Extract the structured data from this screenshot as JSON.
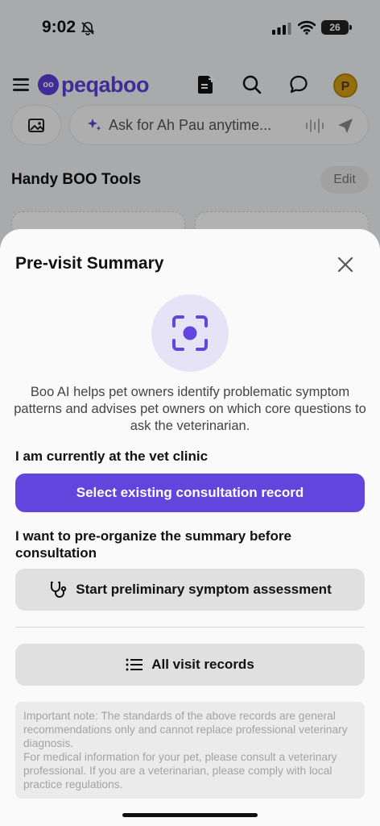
{
  "status": {
    "time": "9:02",
    "battery": "26"
  },
  "nav": {
    "brand": "peqaboo",
    "logo_mark": "oo",
    "avatar_letter": "P"
  },
  "search": {
    "placeholder": "Ask for Ah Pau anytime..."
  },
  "tools": {
    "title": "Handy BOO Tools",
    "edit_label": "Edit"
  },
  "sheet": {
    "title": "Pre-visit Summary",
    "description": "Boo AI helps pet owners identify problematic symptom patterns and advises pet owners on which core questions to ask the veterinarian.",
    "section1_label": "I am currently at the vet clinic",
    "select_record_button": "Select existing consultation record",
    "section2_label": "I want to pre-organize the summary before consultation",
    "assessment_button": "Start preliminary symptom assessment",
    "records_button": "All visit records",
    "note": "Important note: The standards of the above records are general recommendations only and cannot replace professional veterinary diagnosis.",
    "note2": "For medical information for your pet, please consult a veterinary professional. If you are a veterinarian, please comply with local practice regulations."
  },
  "colors": {
    "accent": "#6245dd",
    "brand": "#5b3fd8",
    "hero_bg": "#e5e3f5"
  }
}
